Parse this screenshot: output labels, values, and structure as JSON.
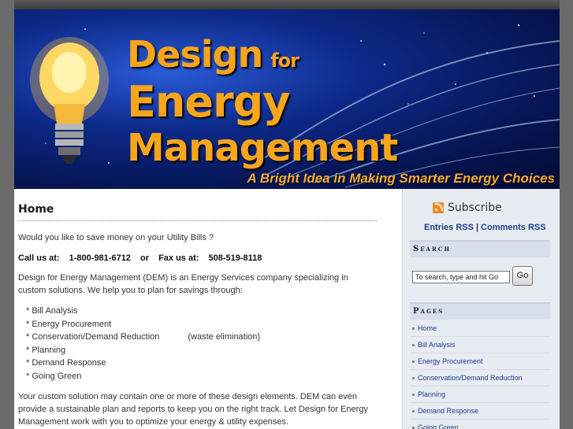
{
  "header": {
    "brand_design": "Design",
    "brand_for": "for",
    "brand_energy": "Energy",
    "brand_management": "Management",
    "tagline": "A Bright Idea in Making Smarter Energy Choices"
  },
  "main": {
    "title": "Home",
    "question": "Would you like to save money on your Utility Bills ?",
    "call_label": "Call us at:",
    "phone": "1-800-981-6712",
    "or": "or",
    "fax_label": "Fax us at:",
    "fax": "508-519-8118",
    "description": "Design for Energy Management (DEM) is an Energy Services company specializing in custom solutions. We help you to plan for savings through:",
    "bullets": [
      "* Bill Analysis",
      "* Energy Procurement",
      "* Conservation/Demand Reduction",
      "* Planning",
      "* Demand Response",
      "* Going Green"
    ],
    "bullet_note": "(waste elimination)",
    "closing": "Your custom solution may contain one or more of these design elements. DEM can even provide a sustainable plan and reports to keep you on the right track. Let Design for Energy Management work with you to optimize your energy & utility expenses."
  },
  "sidebar": {
    "subscribe": "Subscribe",
    "entries_rss": "Entries RSS",
    "separator": "|",
    "comments_rss": "Comments RSS",
    "search_title": "Search",
    "search_value": "To search, type and hit Go",
    "go_label": "Go",
    "pages_title": "Pages",
    "pages": [
      "Home",
      "Bill Analysis",
      "Energy Procurement",
      "Conservation/Demand Reduction",
      "Planning",
      "Demand Response",
      "Going Green"
    ]
  },
  "colors": {
    "brand_orange": "#f7a51c",
    "link_blue": "#1d3f89",
    "banner_blue": "#0d2a8a"
  }
}
